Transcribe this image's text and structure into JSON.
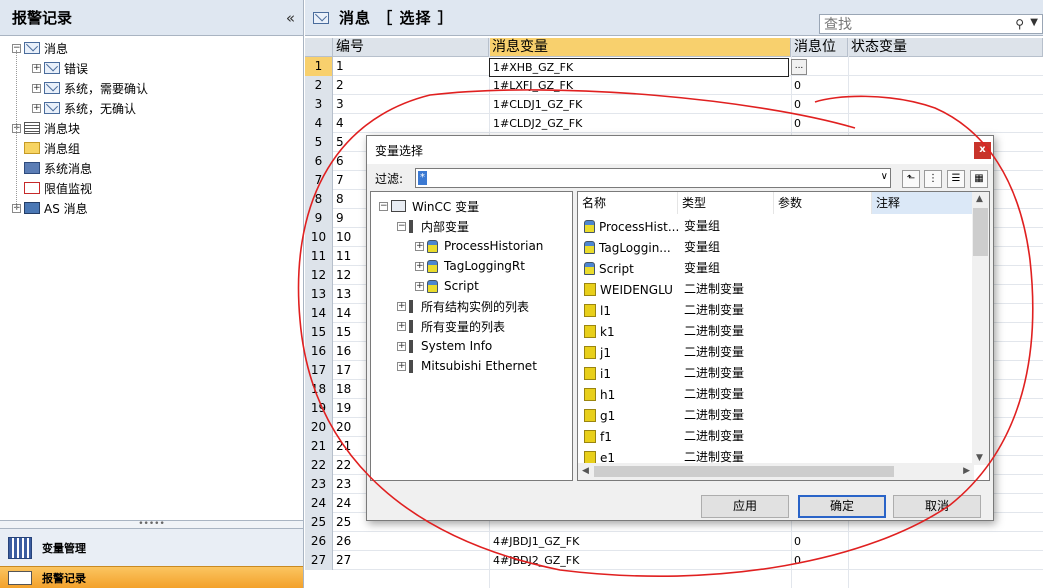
{
  "left_panel": {
    "title": "报警记录",
    "collapse_glyph": "«",
    "tree": [
      {
        "label": "消息",
        "expand": "−",
        "icon": "mail-icon",
        "level": 0
      },
      {
        "label": "错误",
        "expand": "+",
        "icon": "mail-icon",
        "level": 1
      },
      {
        "label": "系统，需要确认",
        "expand": "+",
        "icon": "mail-icon",
        "level": 1
      },
      {
        "label": "系统，无确认",
        "expand": "+",
        "icon": "mail-icon",
        "level": 1
      },
      {
        "label": "消息块",
        "expand": "+",
        "icon": "block-icon",
        "level": 0
      },
      {
        "label": "消息组",
        "expand": "",
        "icon": "folder-icon",
        "level": 0
      },
      {
        "label": "系统消息",
        "expand": "",
        "icon": "system-icon",
        "level": 0
      },
      {
        "label": "限值监视",
        "expand": "",
        "icon": "limit-icon",
        "level": 0
      },
      {
        "label": "AS 消息",
        "expand": "+",
        "icon": "as-icon",
        "level": 0
      }
    ],
    "grip": "•••••",
    "nav_items": [
      {
        "label": "变量管理"
      },
      {
        "label": "报警记录"
      }
    ]
  },
  "main_panel": {
    "title": "消息 ［ 选择 ］",
    "search_placeholder": "查找",
    "search_icon": "search-icon",
    "columns": [
      "编号",
      "消息变量",
      "消息位",
      "状态变量"
    ],
    "selected_row": 1,
    "rows": [
      {
        "n": "1",
        "num": "1",
        "var": "1#XHB_GZ_FK",
        "bit": ""
      },
      {
        "n": "2",
        "num": "2",
        "var": "1#LXFJ_GZ_FK",
        "bit": "0"
      },
      {
        "n": "3",
        "num": "3",
        "var": "1#CLDJ1_GZ_FK",
        "bit": "0"
      },
      {
        "n": "4",
        "num": "4",
        "var": "1#CLDJ2_GZ_FK",
        "bit": "0"
      },
      {
        "n": "5",
        "num": "5",
        "var": "",
        "bit": ""
      },
      {
        "n": "6",
        "num": "6",
        "var": "",
        "bit": ""
      },
      {
        "n": "7",
        "num": "7",
        "var": "",
        "bit": ""
      },
      {
        "n": "8",
        "num": "8",
        "var": "",
        "bit": ""
      },
      {
        "n": "9",
        "num": "9",
        "var": "",
        "bit": ""
      },
      {
        "n": "10",
        "num": "10",
        "var": "",
        "bit": ""
      },
      {
        "n": "11",
        "num": "11",
        "var": "",
        "bit": ""
      },
      {
        "n": "12",
        "num": "12",
        "var": "",
        "bit": ""
      },
      {
        "n": "13",
        "num": "13",
        "var": "",
        "bit": ""
      },
      {
        "n": "14",
        "num": "14",
        "var": "",
        "bit": ""
      },
      {
        "n": "15",
        "num": "15",
        "var": "",
        "bit": ""
      },
      {
        "n": "16",
        "num": "16",
        "var": "",
        "bit": ""
      },
      {
        "n": "17",
        "num": "17",
        "var": "",
        "bit": ""
      },
      {
        "n": "18",
        "num": "18",
        "var": "",
        "bit": ""
      },
      {
        "n": "19",
        "num": "19",
        "var": "",
        "bit": ""
      },
      {
        "n": "20",
        "num": "20",
        "var": "",
        "bit": ""
      },
      {
        "n": "21",
        "num": "21",
        "var": "",
        "bit": ""
      },
      {
        "n": "22",
        "num": "22",
        "var": "",
        "bit": ""
      },
      {
        "n": "23",
        "num": "23",
        "var": "",
        "bit": ""
      },
      {
        "n": "24",
        "num": "24",
        "var": "",
        "bit": ""
      },
      {
        "n": "25",
        "num": "25",
        "var": "",
        "bit": ""
      },
      {
        "n": "26",
        "num": "26",
        "var": "4#JBDJ1_GZ_FK",
        "bit": "0"
      },
      {
        "n": "27",
        "num": "27",
        "var": "4#JBDJ2_GZ_FK",
        "bit": "0"
      }
    ],
    "ellipsis_label": "..."
  },
  "dialog": {
    "title": "变量选择",
    "close_glyph": "x",
    "filter_label": "过滤:",
    "filter_value": "*",
    "tree": [
      {
        "label": "WinCC 变量",
        "expand": "−",
        "icon": "computer-icon",
        "level": 0
      },
      {
        "label": "内部变量",
        "expand": "−",
        "icon": "connection-icon",
        "level": 1
      },
      {
        "label": "ProcessHistorian",
        "expand": "+",
        "icon": "tag-group-icon",
        "level": 2
      },
      {
        "label": "TagLoggingRt",
        "expand": "+",
        "icon": "tag-group-icon",
        "level": 2
      },
      {
        "label": "Script",
        "expand": "+",
        "icon": "tag-group-icon",
        "level": 2
      },
      {
        "label": "所有结构实例的列表",
        "expand": "+",
        "icon": "connection-icon",
        "level": 1
      },
      {
        "label": "所有变量的列表",
        "expand": "+",
        "icon": "connection-icon",
        "level": 1
      },
      {
        "label": "System Info",
        "expand": "+",
        "icon": "connection-icon",
        "level": 1
      },
      {
        "label": "Mitsubishi Ethernet",
        "expand": "+",
        "icon": "connection-icon",
        "level": 1
      }
    ],
    "columns": [
      "名称",
      "类型",
      "参数",
      "注释"
    ],
    "items": [
      {
        "name": "ProcessHist...",
        "type": "变量组",
        "icon": "tag-group-icon"
      },
      {
        "name": "TagLoggin...",
        "type": "变量组",
        "icon": "tag-group-icon"
      },
      {
        "name": "Script",
        "type": "变量组",
        "icon": "tag-group-icon"
      },
      {
        "name": "WEIDENGLU",
        "type": "二进制变量",
        "icon": "binary-tag-icon"
      },
      {
        "name": "l1",
        "type": "二进制变量",
        "icon": "binary-tag-icon"
      },
      {
        "name": "k1",
        "type": "二进制变量",
        "icon": "binary-tag-icon"
      },
      {
        "name": "j1",
        "type": "二进制变量",
        "icon": "binary-tag-icon"
      },
      {
        "name": "i1",
        "type": "二进制变量",
        "icon": "binary-tag-icon"
      },
      {
        "name": "h1",
        "type": "二进制变量",
        "icon": "binary-tag-icon"
      },
      {
        "name": "g1",
        "type": "二进制变量",
        "icon": "binary-tag-icon"
      },
      {
        "name": "f1",
        "type": "二进制变量",
        "icon": "binary-tag-icon"
      },
      {
        "name": "e1",
        "type": "二进制变量",
        "icon": "binary-tag-icon"
      }
    ],
    "buttons": {
      "apply": "应用",
      "ok": "确定",
      "cancel": "取消"
    }
  },
  "colors": {
    "header_bg": "#dfe7f1",
    "selected_row": "#f8d06d",
    "active_nav": "#f3a12b",
    "annotation": "#e02020",
    "close_button": "#c8342b"
  }
}
